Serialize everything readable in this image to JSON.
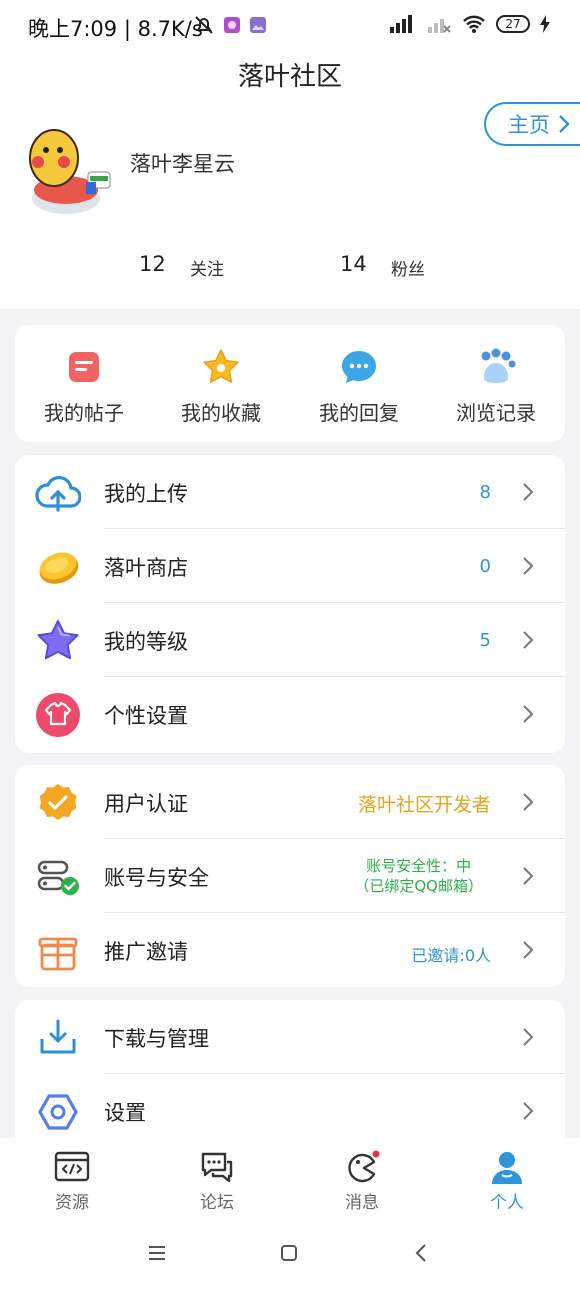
{
  "status_bar": {
    "time_speed": "晚上7:09 | 8.7K/s",
    "battery": "27"
  },
  "app": {
    "title": "落叶社区"
  },
  "profile": {
    "username": "落叶李星云",
    "home_button": "主页",
    "following_count": "12",
    "following_label": "关注",
    "followers_count": "14",
    "followers_label": "粉丝"
  },
  "quick_actions": [
    {
      "label": "我的帖子",
      "icon": "posts-icon"
    },
    {
      "label": "我的收藏",
      "icon": "star-icon"
    },
    {
      "label": "我的回复",
      "icon": "chat-bubble-icon"
    },
    {
      "label": "浏览记录",
      "icon": "paw-icon"
    }
  ],
  "menu_group_1": [
    {
      "label": "我的上传",
      "value": "8",
      "icon": "cloud-upload-icon"
    },
    {
      "label": "落叶商店",
      "value": "0",
      "icon": "coin-icon"
    },
    {
      "label": "我的等级",
      "value": "5",
      "icon": "star-badge-icon"
    },
    {
      "label": "个性设置",
      "value": "",
      "icon": "tshirt-icon"
    }
  ],
  "menu_group_2": [
    {
      "label": "用户认证",
      "value": "落叶社区开发者",
      "icon": "verified-badge-icon"
    },
    {
      "label": "账号与安全",
      "value_line1": "账号安全性：中",
      "value_line2": "（已绑定QQ邮箱）",
      "icon": "account-security-icon"
    },
    {
      "label": "推广邀请",
      "value": "已邀请:0人",
      "icon": "gift-icon"
    }
  ],
  "menu_group_3": [
    {
      "label": "下载与管理",
      "icon": "download-icon"
    },
    {
      "label": "设置",
      "icon": "settings-hexagon-icon"
    }
  ],
  "tab_bar": [
    {
      "label": "资源",
      "icon": "code-icon"
    },
    {
      "label": "论坛",
      "icon": "forum-icon"
    },
    {
      "label": "消息",
      "icon": "message-icon"
    },
    {
      "label": "个人",
      "icon": "user-icon",
      "active": true
    }
  ],
  "colors": {
    "accent": "#2e95d8",
    "gold": "#e6a519",
    "green": "#2bb24c",
    "background": "#f4f4f6"
  }
}
